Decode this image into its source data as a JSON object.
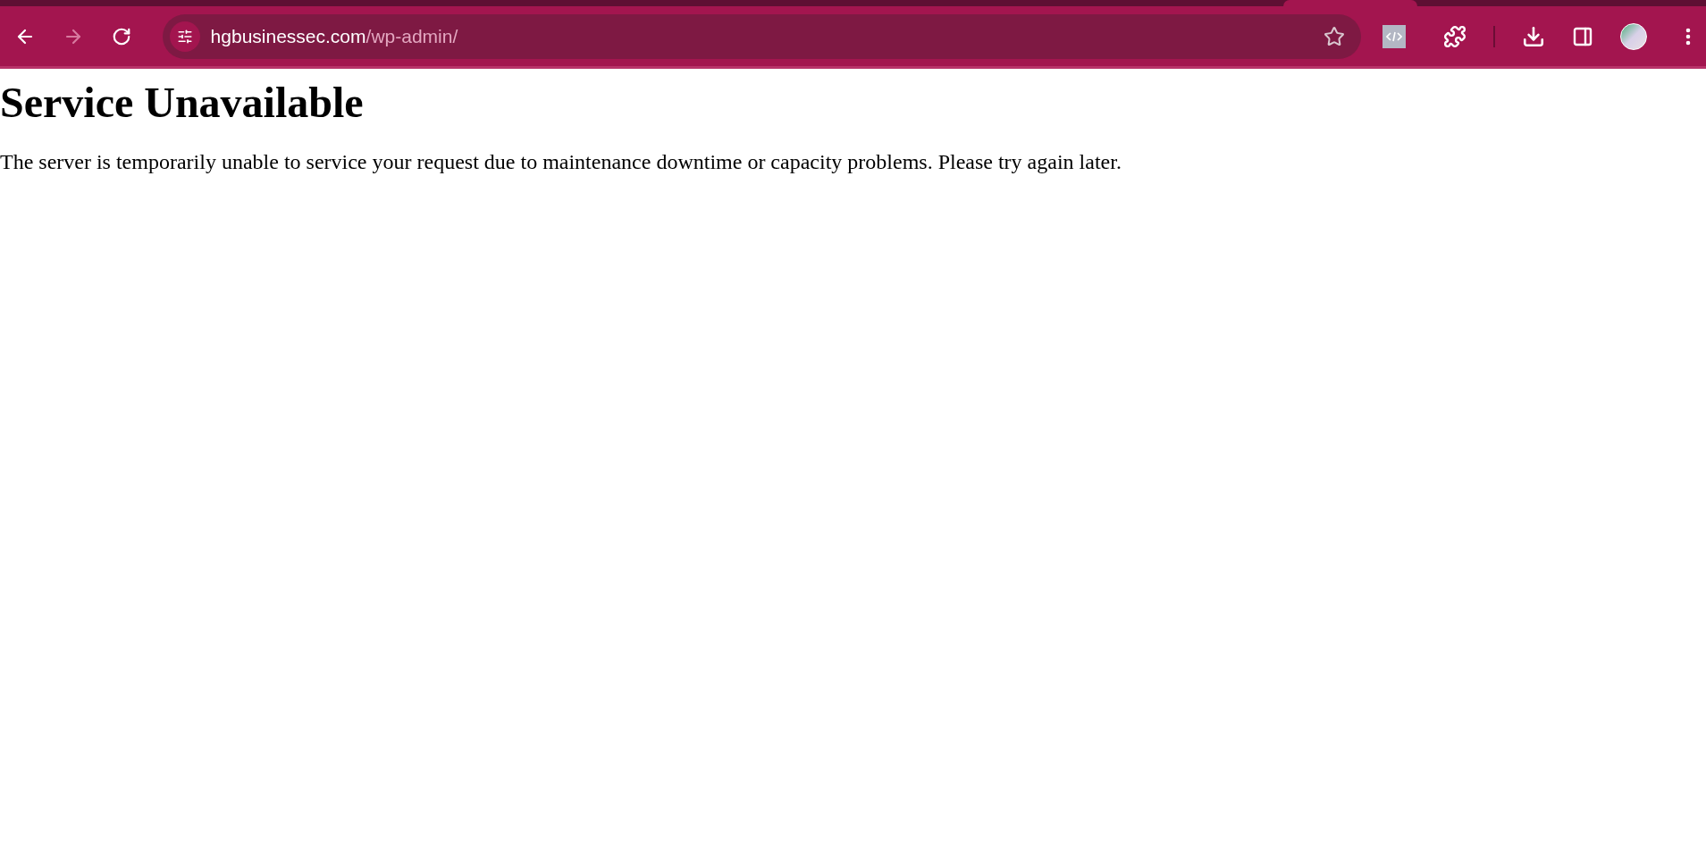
{
  "browser": {
    "back": {
      "disabled": false
    },
    "forward": {
      "disabled": true
    },
    "address": {
      "host": "hgbusinessec.com",
      "path": "/wp-admin/"
    }
  },
  "page": {
    "heading": "Service Unavailable",
    "message": "The server is temporarily unable to service your request due to maintenance downtime or capacity problems. Please try again later."
  }
}
